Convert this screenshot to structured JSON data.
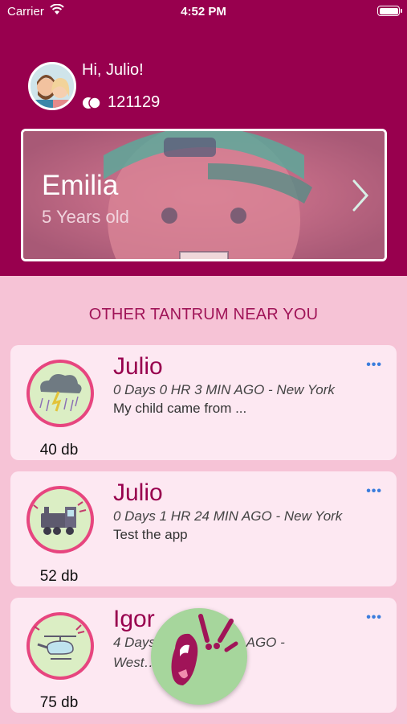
{
  "status_bar": {
    "carrier": "Carrier",
    "time": "4:52 PM"
  },
  "user": {
    "greeting": "Hi, Julio!",
    "coins": "121129"
  },
  "child": {
    "name": "Emilia",
    "age": "5 Years old"
  },
  "section_title": "OTHER TANTRUM NEAR YOU",
  "posts": [
    {
      "name": "Julio",
      "meta": "0 Days 0 HR 3 MIN AGO - New York",
      "description": "My child came from ...",
      "db": "40 db",
      "icon": "storm-cloud-icon"
    },
    {
      "name": "Julio",
      "meta": "0 Days 1 HR 24 MIN AGO - New York",
      "description": "Test the app",
      "db": "52 db",
      "icon": "train-icon"
    },
    {
      "name": "Igor",
      "meta": "4 Days … HR … MIN AGO -",
      "meta2": "West…",
      "description": "",
      "db": "75 db",
      "icon": "helicopter-icon"
    }
  ],
  "more_label": "•••",
  "colors": {
    "header": "#98004e",
    "background": "#f6c3d6",
    "card": "#fde8f2",
    "accent": "#a01458",
    "link": "#3b7ddd",
    "fab": "#a6d69c"
  },
  "fab_icon": "screaming-mouth-icon"
}
